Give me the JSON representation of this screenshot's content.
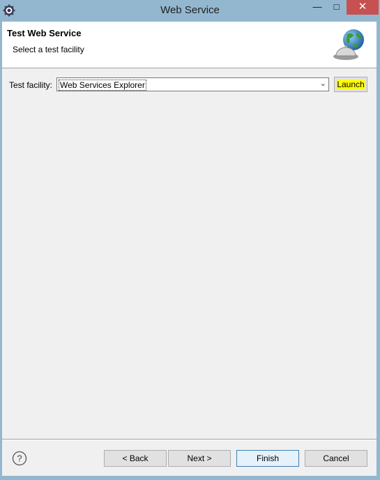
{
  "window": {
    "title": "Web Service",
    "minimize_glyph": "—",
    "maximize_glyph": "□",
    "close_glyph": "✕"
  },
  "banner": {
    "title": "Test Web Service",
    "subtitle": "Select a test facility",
    "icon": "globe-bell-icon"
  },
  "form": {
    "test_facility_label": "Test facility:",
    "test_facility_value": "Web Services Explorer",
    "launch_label": "Launch",
    "launch_highlight_color": "#ffff00"
  },
  "footer": {
    "back_label": "< Back",
    "next_label": "Next >",
    "finish_label": "Finish",
    "cancel_label": "Cancel"
  },
  "colors": {
    "titlebar": "#93b7cf",
    "close_button": "#c75050",
    "dialog_background": "#f0f0f0"
  }
}
